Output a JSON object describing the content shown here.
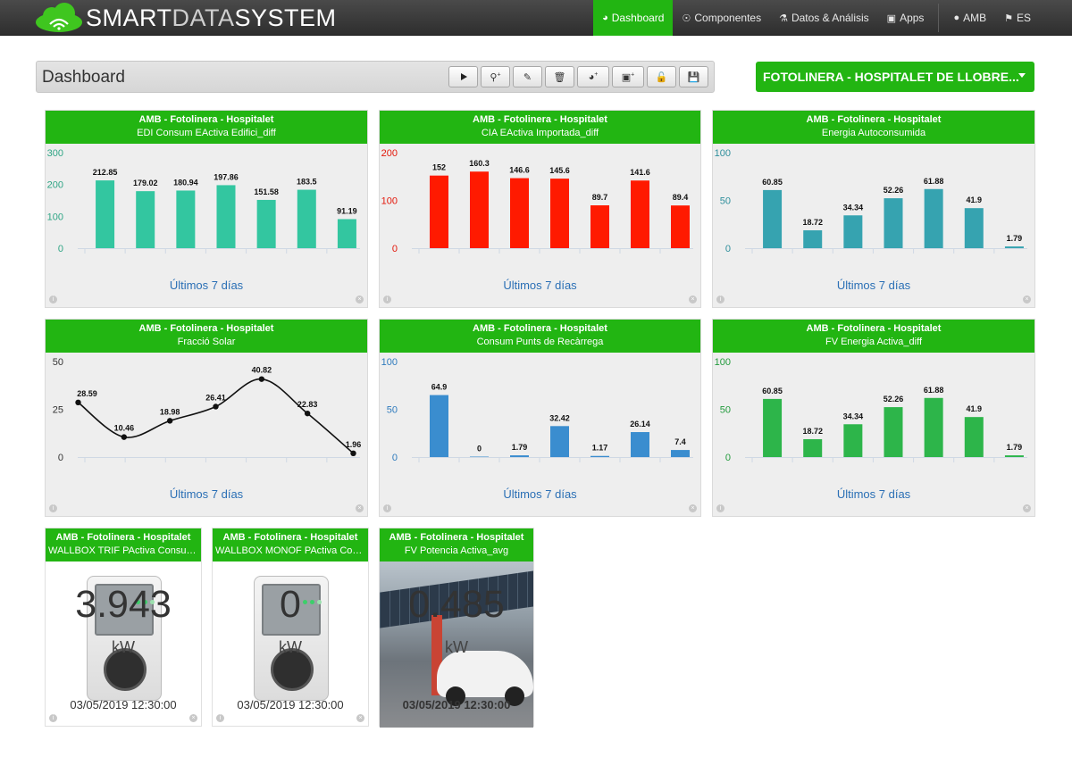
{
  "brand": {
    "part1": "SMART",
    "part2": "DATA",
    "part3": "SYSTEM"
  },
  "nav": {
    "dashboard": "Dashboard",
    "componentes": "Componentes",
    "datos": "Datos & Análisis",
    "apps": "Apps",
    "user": "AMB",
    "lang": "ES"
  },
  "toolbar": {
    "title": "Dashboard"
  },
  "selector": {
    "value": "FOTOLINERA - HOSPITALET DE LLOBRE..."
  },
  "footer_label": "Últimos 7 días",
  "colors": {
    "accent": "#22b512",
    "teal": "#33c6a0",
    "red": "#ff1a00",
    "cyan": "#36a3b0",
    "blue": "#3a8dcf",
    "green": "#2db54a"
  },
  "widgets": [
    {
      "title": "AMB - Fotolinera - Hospitalet",
      "subtitle": "EDI Consum EActiva Edifici_diff"
    },
    {
      "title": "AMB - Fotolinera - Hospitalet",
      "subtitle": "CIA EActiva Importada_diff"
    },
    {
      "title": "AMB - Fotolinera - Hospitalet",
      "subtitle": "Energia Autoconsumida"
    },
    {
      "title": "AMB - Fotolinera - Hospitalet",
      "subtitle": "Fracció Solar"
    },
    {
      "title": "AMB - Fotolinera - Hospitalet",
      "subtitle": "Consum Punts de Recàrrega"
    },
    {
      "title": "AMB - Fotolinera - Hospitalet",
      "subtitle": "FV Energia Activa_diff"
    },
    {
      "title": "AMB - Fotolinera - Hospitalet",
      "subtitle": "WALLBOX TRIF PActiva Consum...",
      "value": "3.943",
      "unit": "kW",
      "timestamp": "03/05/2019 12:30:00"
    },
    {
      "title": "AMB - Fotolinera - Hospitalet",
      "subtitle": "WALLBOX MONOF PActiva Cons...",
      "value": "0",
      "unit": "kW",
      "timestamp": "03/05/2019 12:30:00"
    },
    {
      "title": "AMB - Fotolinera - Hospitalet",
      "subtitle": "FV Potencia Activa_avg",
      "value": "0.485",
      "unit": "kW",
      "timestamp": "03/05/2019 12:30:00"
    }
  ],
  "chart_data": [
    {
      "type": "bar",
      "ylim": [
        0,
        300
      ],
      "yticks": [
        0,
        100,
        200,
        300
      ],
      "values": [
        212.85,
        179.02,
        180.94,
        197.86,
        151.58,
        183.5,
        91.19
      ],
      "labels": [
        "212.85",
        "179.02",
        "180.94",
        "197.86",
        "151.58",
        "183.5",
        "91.19"
      ],
      "color": "#33c6a0",
      "tickcolor": "#2fa585"
    },
    {
      "type": "bar",
      "ylim": [
        0,
        200
      ],
      "yticks": [
        0,
        100,
        200
      ],
      "values": [
        152,
        160.3,
        146.6,
        145.6,
        89.7,
        141.6,
        89.4
      ],
      "labels": [
        "152",
        "160.3",
        "146.6",
        "145.6",
        "89.7",
        "141.6",
        "89.4"
      ],
      "color": "#ff1a00",
      "tickcolor": "#e3170a"
    },
    {
      "type": "bar",
      "ylim": [
        0,
        100
      ],
      "yticks": [
        0,
        50,
        100
      ],
      "values": [
        60.85,
        18.72,
        34.34,
        52.26,
        61.88,
        41.9,
        1.79
      ],
      "labels": [
        "60.85",
        "18.72",
        "34.34",
        "52.26",
        "61.88",
        "41.9",
        "1.79"
      ],
      "color": "#36a3b0",
      "tickcolor": "#2f8f9c"
    },
    {
      "type": "line",
      "ylim": [
        0,
        50
      ],
      "yticks": [
        0,
        25,
        50
      ],
      "values": [
        28.59,
        10.46,
        18.98,
        26.41,
        40.82,
        22.83,
        1.96
      ],
      "labels": [
        "28.59",
        "10.46",
        "18.98",
        "26.41",
        "40.82",
        "22.83",
        "1.96"
      ],
      "color": "#111111",
      "tickcolor": "#333333"
    },
    {
      "type": "bar",
      "ylim": [
        0,
        100
      ],
      "yticks": [
        0,
        50,
        100
      ],
      "values": [
        64.9,
        0,
        1.79,
        32.42,
        1.17,
        26.14,
        7.4
      ],
      "labels": [
        "64.9",
        "0",
        "1.79",
        "32.42",
        "1.17",
        "26.14",
        "7.4"
      ],
      "color": "#3a8dcf",
      "tickcolor": "#2f7bbd"
    },
    {
      "type": "bar",
      "ylim": [
        0,
        100
      ],
      "yticks": [
        0,
        50,
        100
      ],
      "values": [
        60.85,
        18.72,
        34.34,
        52.26,
        61.88,
        41.9,
        1.79
      ],
      "labels": [
        "60.85",
        "18.72",
        "34.34",
        "52.26",
        "61.88",
        "41.9",
        "1.79"
      ],
      "color": "#2db54a",
      "tickcolor": "#239b3d"
    }
  ]
}
